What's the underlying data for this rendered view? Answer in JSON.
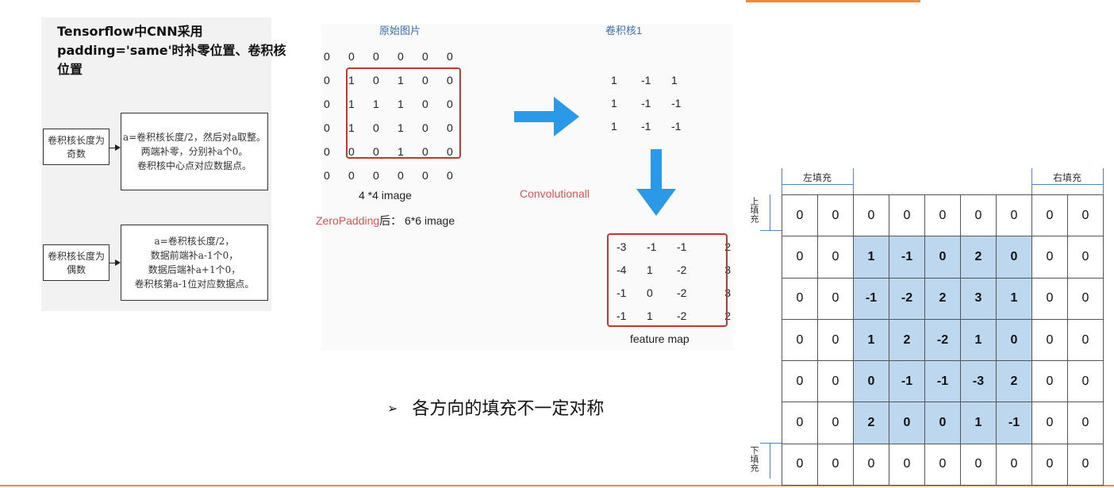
{
  "left": {
    "title": "Tensorflow中CNN采用padding='same'时补零位置、卷积核位置",
    "odd": {
      "condition": "卷积核长度为奇数",
      "lines": [
        "a=卷积核长度/2，然后对a取整。",
        "两端补零，分别补a个0。",
        "卷积核中心点对应数据点。"
      ]
    },
    "even": {
      "condition": "卷积核长度为偶数",
      "lines": [
        "a=卷积核长度/2，",
        "数据前端补a-1个0，",
        "数据后端补a+1个0，",
        "卷积核第a-1位对应数据点。"
      ]
    }
  },
  "middle": {
    "original_label": "原始图片",
    "kernel_label": "卷积核1",
    "padded": [
      [
        "0",
        "0",
        "0",
        "0",
        "0",
        "0"
      ],
      [
        "0",
        "1",
        "0",
        "1",
        "0",
        "0"
      ],
      [
        "0",
        "1",
        "1",
        "1",
        "0",
        "0"
      ],
      [
        "0",
        "1",
        "0",
        "1",
        "0",
        "0"
      ],
      [
        "0",
        "0",
        "0",
        "1",
        "0",
        "0"
      ],
      [
        "0",
        "0",
        "0",
        "0",
        "0",
        "0"
      ]
    ],
    "image_caption": "4 *4 image",
    "padding_caption_red": "ZeroPadding",
    "padding_caption_rest": "后：  6*6 image",
    "conv_label": "Convolutionall",
    "kernel": [
      [
        "1",
        "-1",
        "1"
      ],
      [
        "1",
        "-1",
        "-1"
      ],
      [
        "1",
        "-1",
        "-1"
      ]
    ],
    "feature_map": [
      [
        "-3",
        "-1",
        "-1",
        "2"
      ],
      [
        "-4",
        "1",
        "-2",
        "3"
      ],
      [
        "-1",
        "0",
        "-2",
        "3"
      ],
      [
        "-1",
        "1",
        "-2",
        "2"
      ]
    ],
    "feature_caption": "feature map",
    "colors": {
      "arrow": "#2a9ae8",
      "box": "#c0392b"
    }
  },
  "bullet": {
    "icon": "➢",
    "text": "各方向的填充不一定对称"
  },
  "right": {
    "left_pad_label": "左填充",
    "right_pad_label": "右填充",
    "top_pad_label": "上填充",
    "bottom_pad_label": "下填充",
    "rows": [
      [
        "0",
        "0",
        "0",
        "0",
        "0",
        "0",
        "0",
        "0",
        "0"
      ],
      [
        "0",
        "0",
        "1",
        "-1",
        "0",
        "2",
        "0",
        "0",
        "0"
      ],
      [
        "0",
        "0",
        "-1",
        "-2",
        "2",
        "3",
        "1",
        "0",
        "0"
      ],
      [
        "0",
        "0",
        "1",
        "2",
        "-2",
        "1",
        "0",
        "0",
        "0"
      ],
      [
        "0",
        "0",
        "0",
        "-1",
        "-1",
        "-3",
        "2",
        "0",
        "0"
      ],
      [
        "0",
        "0",
        "2",
        "0",
        "0",
        "1",
        "-1",
        "0",
        "0"
      ],
      [
        "0",
        "0",
        "0",
        "0",
        "0",
        "0",
        "0",
        "0",
        "0"
      ]
    ],
    "highlight_color": "#bdd7ee"
  }
}
